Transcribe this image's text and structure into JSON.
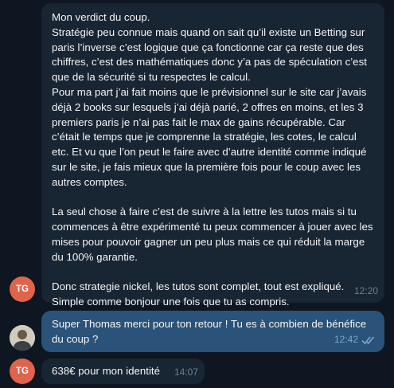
{
  "messages": [
    {
      "sender_initials": "TG",
      "text": "Mon verdict du coup.\nStratégie peu connue mais quand on sait qu’il existe un Betting sur paris l’inverse c’est logique que ça fonctionne car ça reste que des chiffres, c’est des mathématiques donc y’a pas de spéculation c’est que de la sécurité si tu respectes le calcul.\nPour ma part j’ai fait moins que le prévisionnel sur le site car j’avais déjà 2 books sur lesquels j’ai déjà parié, 2 offres en moins, et les 3 premiers paris je n’ai pas fait le max de gains récupérable. Car c’était le temps que je comprenne la stratégie, les cotes, le calcul etc. Et vu que l’on peut le faire avec d’autre identité comme indiqué sur le site, je fais mieux que la première fois pour le coup avec les autres comptes.\n\nLa seul chose à faire c’est de suivre à la lettre les tutos mais si tu commences à être expérimenté tu peux commencer à jouer avec les mises pour pouvoir gagner un peu plus mais ce qui réduit la marge du 100% garantie.\n\nDonc strategie nickel, les tutos sont complet, tout est expliqué.\nSimple comme bonjour une fois que tu as compris.",
      "time": "12:20"
    },
    {
      "sender_initials": "",
      "text": "Super Thomas merci pour ton retour ! Tu es à combien de bénéfice du coup ?",
      "time": "12:42",
      "read_status": "read-double-check"
    },
    {
      "sender_initials": "TG",
      "text": "638€ pour mon identité",
      "time": "14:07"
    }
  ],
  "colors": {
    "background": "#0e1621",
    "incoming_bubble": "#182533",
    "outgoing_bubble": "#2b5278",
    "avatar_tg": "#e0634c"
  }
}
